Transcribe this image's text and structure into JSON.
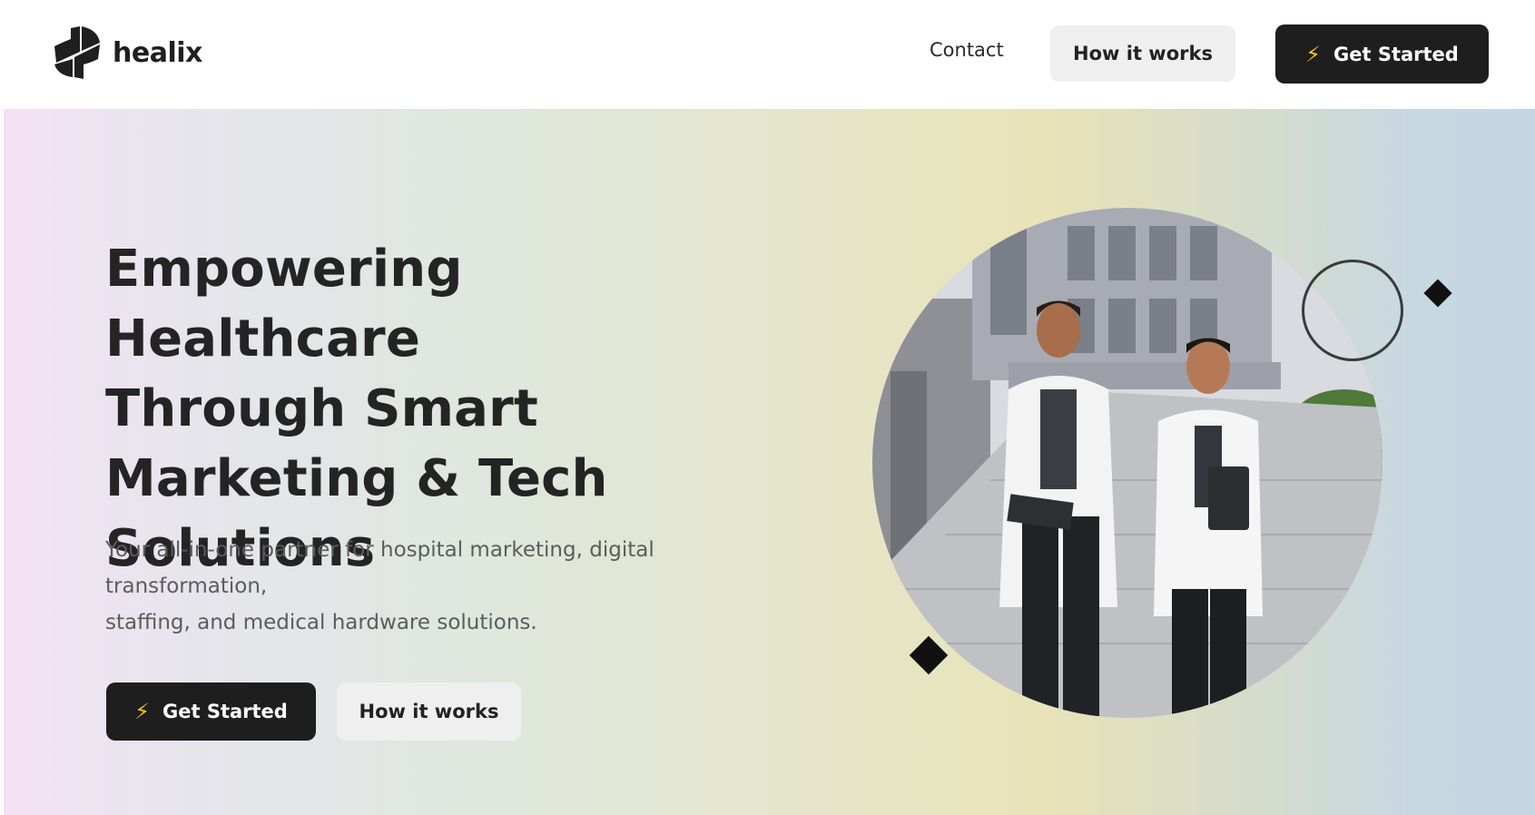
{
  "brand": {
    "name": "healix"
  },
  "nav": {
    "contact_label": "Contact",
    "how_label": "How it works",
    "start_label": "Get Started",
    "start_icon": "lightning-bolt-icon"
  },
  "hero": {
    "headline_lines": [
      "Empowering Healthcare",
      "Through Smart",
      "Marketing & Tech",
      "Solutions"
    ],
    "subtitle_lines": [
      "Your all-in-one partner for hospital marketing, digital",
      "transformation,",
      "staffing, and medical hardware solutions."
    ],
    "start_label": "Get Started",
    "how_label": "How it works",
    "image_alt": "Two doctors in white coats walking outside a hospital"
  },
  "colors": {
    "primary_dark": "#1e1e1e",
    "secondary_light": "#efefef",
    "bolt": "#f5c518"
  }
}
